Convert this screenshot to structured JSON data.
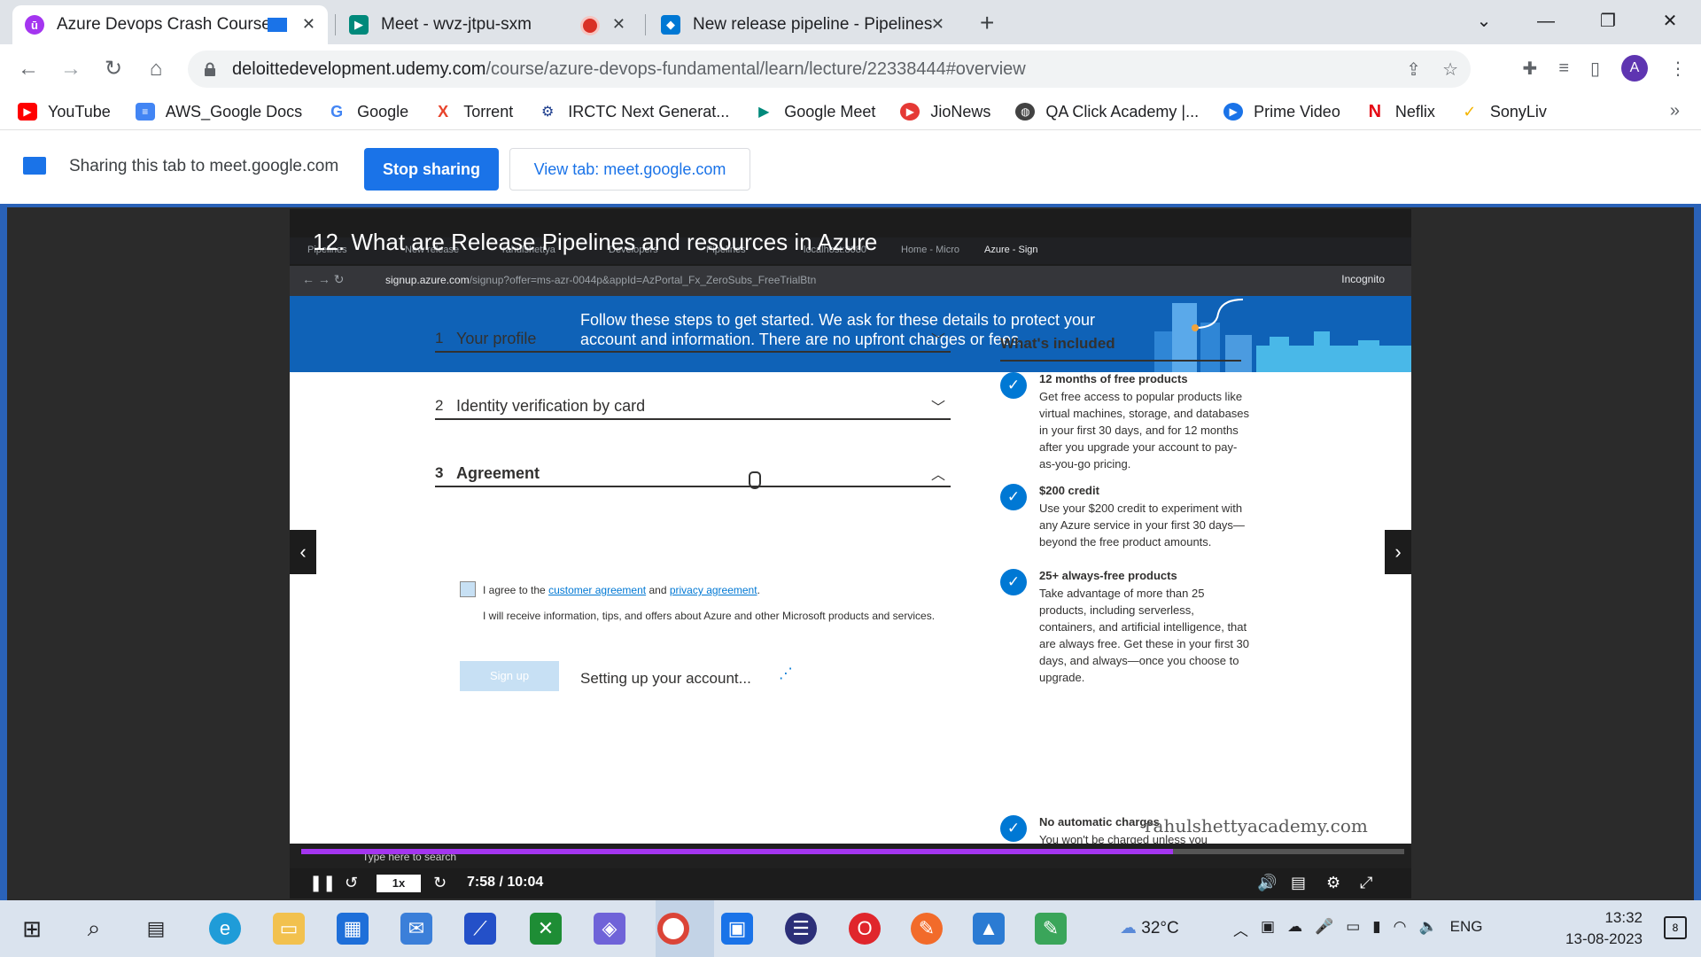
{
  "browser": {
    "tabs": [
      {
        "title": "Azure Devops Crash Course",
        "active": true
      },
      {
        "title": "Meet - wvz-jtpu-sxm",
        "active": false
      },
      {
        "title": "New release pipeline - Pipelines",
        "active": false
      }
    ],
    "new_tab_label": "+",
    "url_domain": "deloittedevelopment.udemy.com",
    "url_path": "/course/azure-devops-fundamental/learn/lecture/22338444#overview",
    "profile_initial": "A",
    "bookmarks": [
      {
        "label": "YouTube",
        "color": "#ff0000"
      },
      {
        "label": "AWS_Google Docs",
        "color": "#4285f4"
      },
      {
        "label": "Google",
        "color": "#4285f4"
      },
      {
        "label": "Torrent",
        "color": "#e8442c"
      },
      {
        "label": "IRCTC Next Generat...",
        "color": "#1b3c8c"
      },
      {
        "label": "Google Meet",
        "color": "#00897b"
      },
      {
        "label": "JioNews",
        "color": "#e53935"
      },
      {
        "label": "QA Click Academy |...",
        "color": "#424242"
      },
      {
        "label": "Prime Video",
        "color": "#1a73e8"
      },
      {
        "label": "Neflix",
        "color": "#e50914"
      },
      {
        "label": "SonyLiv",
        "color": "#f4b400"
      }
    ]
  },
  "sharing": {
    "text": "Sharing this tab to meet.google.com",
    "stop_label": "Stop sharing",
    "view_label": "View tab: meet.google.com"
  },
  "video": {
    "lecture_title": "12. What are Release Pipelines and resources in Azure",
    "inner_tabs": [
      "Pipelines",
      "New release",
      "rahulshettya",
      "Developers",
      "Pipelines",
      "localhost:8080",
      "Home - Micro",
      "Azure - Sign"
    ],
    "inner_url_domain": "signup.azure.com",
    "inner_url_path": "/signup?offer=ms-azr-0044p&appId=AzPortal_Fx_ZeroSubs_FreeTrialBtn",
    "incognito_label": "Incognito",
    "hero_text": "Follow these steps to get started. We ask for these details to protect your account and information. There are no upfront charges or fees.",
    "steps": [
      {
        "num": "1",
        "label": "Your profile"
      },
      {
        "num": "2",
        "label": "Identity verification by card"
      },
      {
        "num": "3",
        "label": "Agreement"
      }
    ],
    "agree_prefix": "I agree to the",
    "agree_link1": "customer agreement",
    "agree_mid": "and",
    "agree_link2": "privacy agreement",
    "agree_suffix": ".",
    "info_text": "I will receive information, tips, and offers about Azure and other Microsoft products and services.",
    "signup_label": "Sign up",
    "setting_up": "Setting up your account...",
    "side_title": "What's included",
    "included": [
      {
        "heading": "12 months of free products",
        "body": "Get free access to popular products like virtual machines, storage, and databases in your first 30 days, and for 12 months after you upgrade your account to pay-as-you-go pricing."
      },
      {
        "heading": "$200 credit",
        "body": "Use your $200 credit to experiment with any Azure service in your first 30 days—beyond the free product amounts."
      },
      {
        "heading": "25+ always-free products",
        "body": "Take advantage of more than 25 products, including serverless, containers, and artificial intelligence, that are always free. Get these in your first 30 days, and always—once you choose to upgrade."
      },
      {
        "heading": "No automatic charges",
        "body": "You won't be charged unless you"
      }
    ],
    "watermark": "rahulshettyacademy.com",
    "inner_search_placeholder": "Type here to search",
    "speed": "1x",
    "time": "7:58 / 10:04",
    "progress_fraction": 0.79,
    "accent": "#a435f0"
  },
  "taskbar": {
    "temperature": "32°C",
    "language": "ENG",
    "time": "13:32",
    "date": "13-08-2023",
    "notification_count": "8"
  }
}
